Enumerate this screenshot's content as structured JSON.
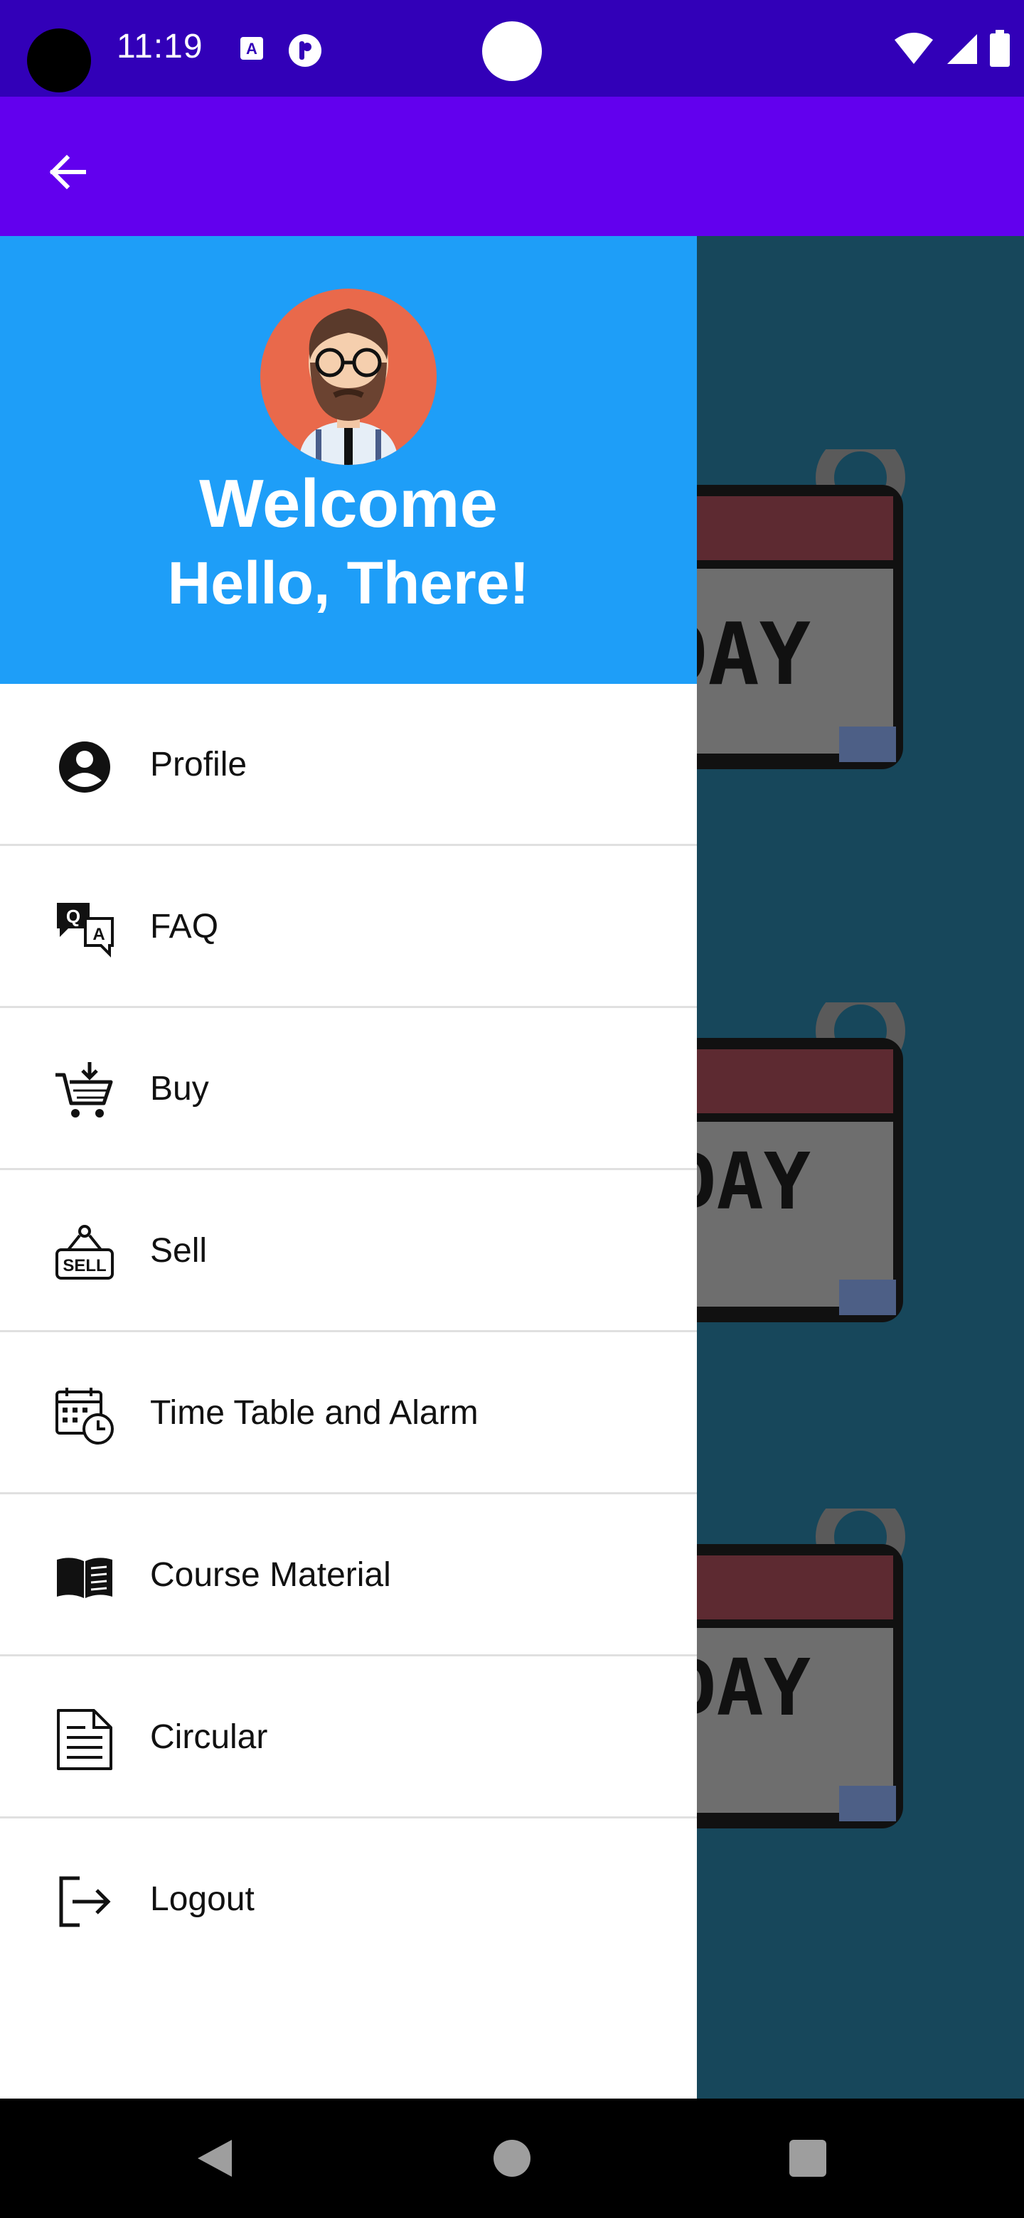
{
  "status_bar": {
    "time": "11:19",
    "icons": [
      "notification-a-icon",
      "notification-p-icon",
      "wifi-icon",
      "signal-icon",
      "battery-icon"
    ]
  },
  "app_bar": {
    "back_icon": "arrow-back-icon",
    "color": "#6200ee"
  },
  "drawer": {
    "header": {
      "avatar_icon": "bearded-man-avatar",
      "welcome": "Welcome",
      "greeting": "Hello, There!",
      "color": "#1e9ef8"
    },
    "items": [
      {
        "label": "Profile",
        "icon": "account-circle-icon"
      },
      {
        "label": "FAQ",
        "icon": "qa-chat-icon"
      },
      {
        "label": "Buy",
        "icon": "cart-download-icon"
      },
      {
        "label": "Sell",
        "icon": "sell-sign-icon"
      },
      {
        "label": "Time Table and Alarm",
        "icon": "calendar-clock-icon"
      },
      {
        "label": "Course Material",
        "icon": "open-book-icon"
      },
      {
        "label": "Circular",
        "icon": "document-icon"
      },
      {
        "label": "Logout",
        "icon": "logout-icon"
      }
    ]
  },
  "background": {
    "cards": [
      "ESDAY",
      "HURS DAY",
      "ATUR DAY"
    ],
    "color": "#17475b"
  },
  "nav_bar": {
    "icons": [
      "nav-back-icon",
      "nav-home-icon",
      "nav-recents-icon"
    ]
  }
}
